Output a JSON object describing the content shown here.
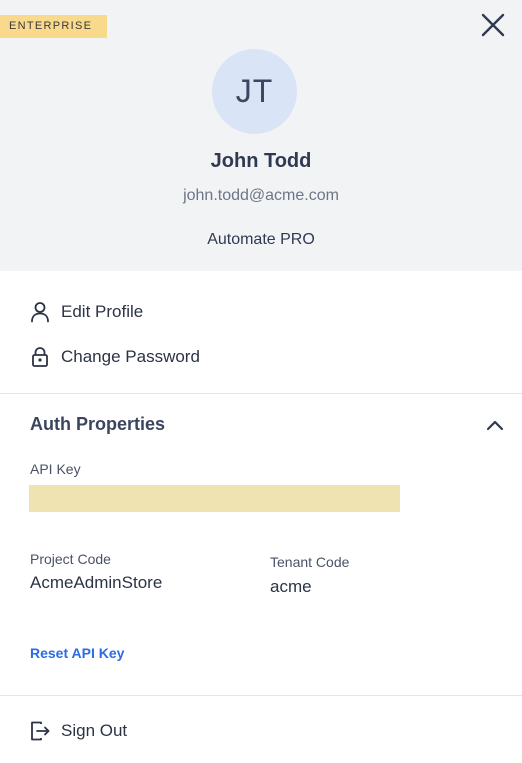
{
  "header": {
    "badge": "ENTERPRISE",
    "avatar_initials": "JT",
    "name": "John Todd",
    "email": "john.todd@acme.com",
    "plan": "Automate PRO"
  },
  "menu": {
    "edit_profile": "Edit Profile",
    "change_password": "Change Password",
    "sign_out": "Sign Out"
  },
  "auth": {
    "title": "Auth Properties",
    "api_key_label": "API Key",
    "api_key_value": "",
    "project_code_label": "Project Code",
    "project_code": "AcmeAdminStore",
    "tenant_code_label": "Tenant Code",
    "tenant_code": "acme",
    "reset_label": "Reset API Key"
  },
  "colors": {
    "badge": "#f9d98c",
    "header_bg": "#f2f3f5",
    "avatar_bg": "#d9e4f6",
    "link": "#2b6be5",
    "redaction": "#efe4b1"
  },
  "icons": {
    "close": "close-icon",
    "user": "user-icon",
    "lock": "lock-icon",
    "chevron": "chevron-up-icon",
    "sign_out": "sign-out-icon"
  }
}
